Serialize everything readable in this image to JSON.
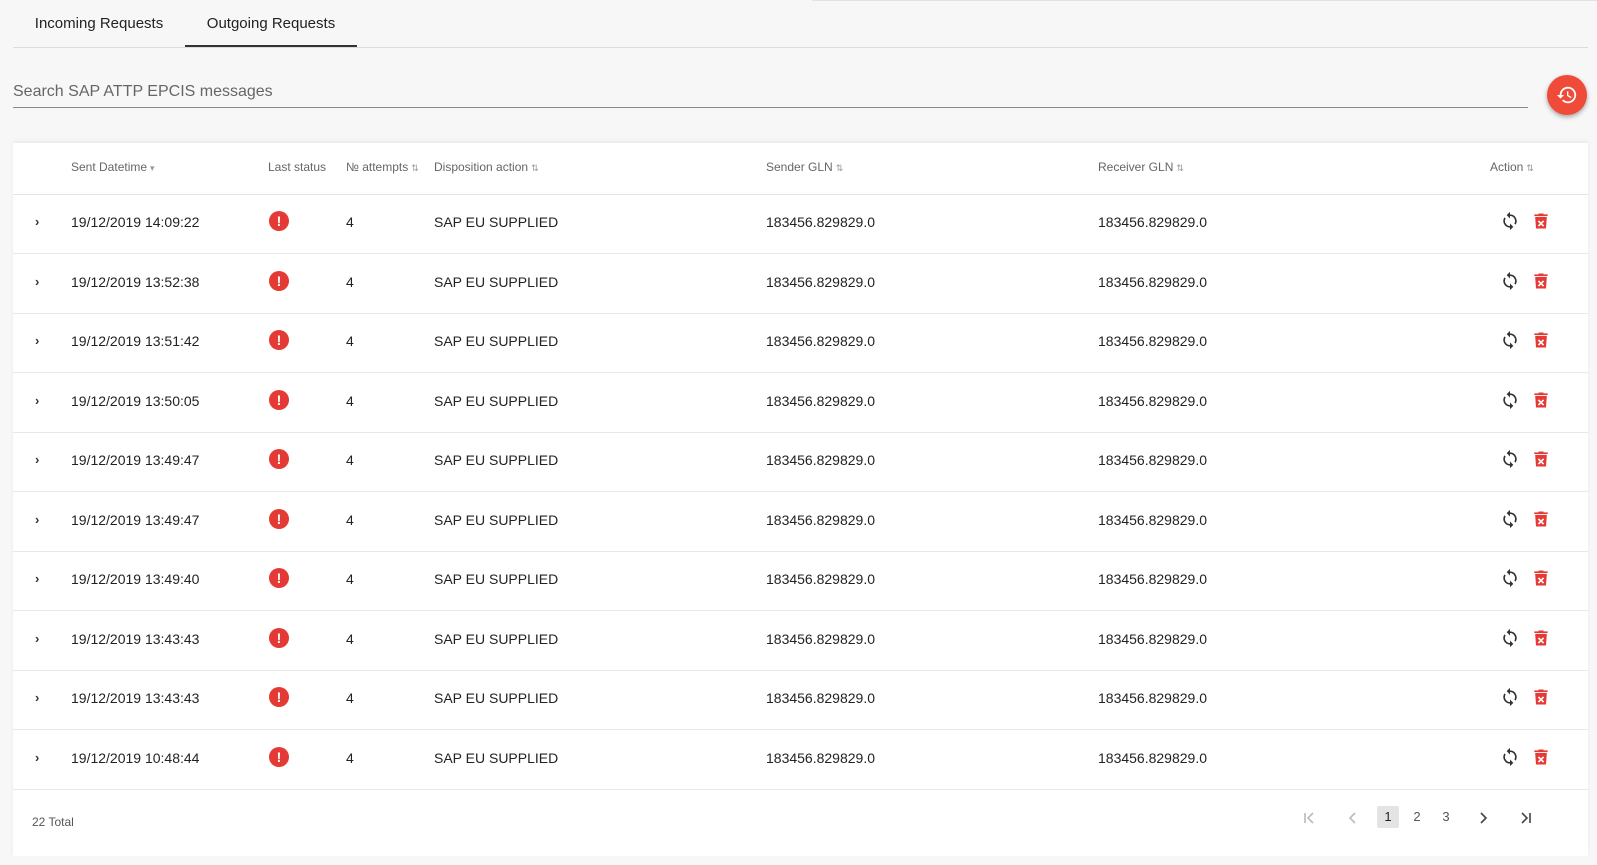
{
  "tabs": [
    "Incoming Requests",
    "Outgoing Requests"
  ],
  "search": {
    "placeholder": "Search SAP ATTP EPCIS messages"
  },
  "fab": {
    "icon": "history-restore-icon"
  },
  "table": {
    "columns": {
      "sent_datetime": "Sent Datetime",
      "last_status": "Last status",
      "attempts": "№ attempts",
      "disposition_action": "Disposition action",
      "sender_gln": "Sender GLN",
      "receiver_gln": "Receiver GLN",
      "action": "Action"
    },
    "rows": [
      {
        "datetime": "19/12/2019 14:09:22",
        "attempts": "4",
        "disposition": "SAP EU SUPPLIED",
        "sender": "183456.829829.0",
        "receiver": "183456.829829.0"
      },
      {
        "datetime": "19/12/2019 13:52:38",
        "attempts": "4",
        "disposition": "SAP EU SUPPLIED",
        "sender": "183456.829829.0",
        "receiver": "183456.829829.0"
      },
      {
        "datetime": "19/12/2019 13:51:42",
        "attempts": "4",
        "disposition": "SAP EU SUPPLIED",
        "sender": "183456.829829.0",
        "receiver": "183456.829829.0"
      },
      {
        "datetime": "19/12/2019 13:50:05",
        "attempts": "4",
        "disposition": "SAP EU SUPPLIED",
        "sender": "183456.829829.0",
        "receiver": "183456.829829.0"
      },
      {
        "datetime": "19/12/2019 13:49:47",
        "attempts": "4",
        "disposition": "SAP EU SUPPLIED",
        "sender": "183456.829829.0",
        "receiver": "183456.829829.0"
      },
      {
        "datetime": "19/12/2019 13:49:47",
        "attempts": "4",
        "disposition": "SAP EU SUPPLIED",
        "sender": "183456.829829.0",
        "receiver": "183456.829829.0"
      },
      {
        "datetime": "19/12/2019 13:49:40",
        "attempts": "4",
        "disposition": "SAP EU SUPPLIED",
        "sender": "183456.829829.0",
        "receiver": "183456.829829.0"
      },
      {
        "datetime": "19/12/2019 13:43:43",
        "attempts": "4",
        "disposition": "SAP EU SUPPLIED",
        "sender": "183456.829829.0",
        "receiver": "183456.829829.0"
      },
      {
        "datetime": "19/12/2019 13:43:43",
        "attempts": "4",
        "disposition": "SAP EU SUPPLIED",
        "sender": "183456.829829.0",
        "receiver": "183456.829829.0"
      },
      {
        "datetime": "19/12/2019 10:48:44",
        "attempts": "4",
        "disposition": "SAP EU SUPPLIED",
        "sender": "183456.829829.0",
        "receiver": "183456.829829.0"
      }
    ]
  },
  "pagination": {
    "total_text": "22 Total",
    "pages": [
      "1",
      "2",
      "3"
    ],
    "current": "1"
  },
  "colors": {
    "accent": "#f04a38",
    "error": "#e53935",
    "delete": "#e53935"
  }
}
